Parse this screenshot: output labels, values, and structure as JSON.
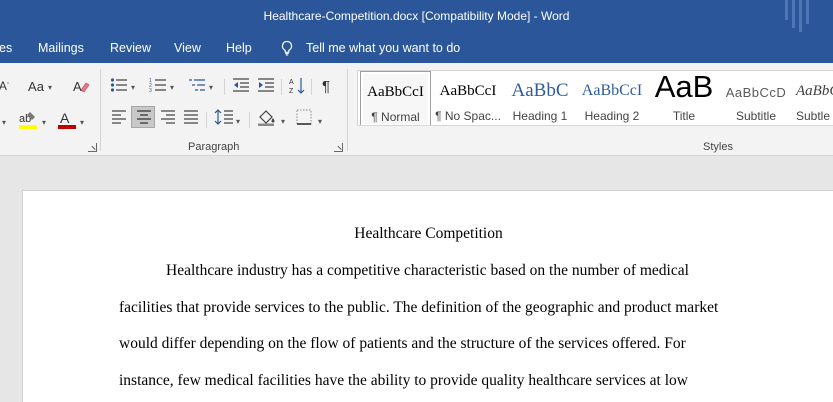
{
  "window": {
    "title": "Healthcare-Competition.docx [Compatibility Mode]  -  Word"
  },
  "menu": {
    "tabs": [
      "es",
      "Mailings",
      "Review",
      "View",
      "Help"
    ],
    "tell_me": "Tell me what you want to do"
  },
  "ribbon": {
    "font_case_label": "Aa",
    "paragraph_label": "Paragraph",
    "styles_label": "Styles",
    "styles": [
      {
        "preview": "AaBbCcI",
        "name": "¶ Normal",
        "selected": true
      },
      {
        "preview": "AaBbCcI",
        "name": "¶ No Spac..."
      },
      {
        "preview": "AaBbC",
        "name": "Heading 1"
      },
      {
        "preview": "AaBbCcI",
        "name": "Heading 2"
      },
      {
        "preview": "AaB",
        "name": "Title"
      },
      {
        "preview": "AaBbCcD",
        "name": "Subtitle"
      },
      {
        "preview": "AaBbC",
        "name": "Subtle E"
      }
    ],
    "colors": {
      "highlight": "#ffff00",
      "font_color": "#c00000",
      "brand": "#2b579a"
    }
  },
  "document": {
    "title": "Healthcare Competition",
    "lines": [
      "Healthcare industry has a competitive characteristic based on the number of medical",
      "facilities that provide services to the public. The definition of the geographic and product market",
      "would differ depending on the flow of patients and the structure of the services offered. For",
      "instance, few medical facilities have the ability to provide quality healthcare services at low"
    ]
  }
}
